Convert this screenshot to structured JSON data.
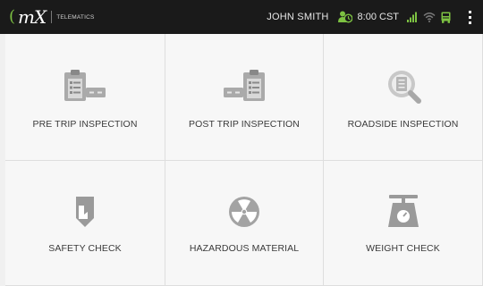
{
  "app": {
    "brand_logo_text": "mX",
    "brand_sub": "TELEMATICS"
  },
  "status": {
    "user_name": "JOHN SMITH",
    "time": "8:00 CST",
    "icons": [
      "driver-status-icon",
      "signal-icon",
      "wifi-icon",
      "truck-icon",
      "overflow-menu-icon"
    ],
    "accent_color": "#7dc242"
  },
  "tiles": [
    {
      "label": "PRE TRIP INSPECTION",
      "icon": "pre-trip-inspection-icon"
    },
    {
      "label": "POST TRIP INSPECTION",
      "icon": "post-trip-inspection-icon"
    },
    {
      "label": "ROADSIDE INSPECTION",
      "icon": "roadside-inspection-icon"
    },
    {
      "label": "SAFETY CHECK",
      "icon": "safety-check-icon"
    },
    {
      "label": "HAZARDOUS MATERIAL",
      "icon": "hazardous-material-icon"
    },
    {
      "label": "WEIGHT CHECK",
      "icon": "weight-check-icon"
    }
  ]
}
